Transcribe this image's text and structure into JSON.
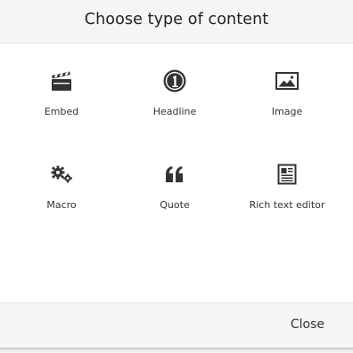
{
  "dialog": {
    "title": "Choose type of content",
    "close_label": "Close"
  },
  "content_types": [
    {
      "label": "Embed",
      "icon": "clapperboard-icon"
    },
    {
      "label": "Headline",
      "icon": "circled-one-icon"
    },
    {
      "label": "Image",
      "icon": "image-icon"
    },
    {
      "label": "Macro",
      "icon": "gears-icon"
    },
    {
      "label": "Quote",
      "icon": "quote-icon"
    },
    {
      "label": "Rich text editor",
      "icon": "rich-text-icon"
    }
  ],
  "colors": {
    "header_bg": "#f5f5f5",
    "icon": "#333333",
    "text": "#333333"
  }
}
